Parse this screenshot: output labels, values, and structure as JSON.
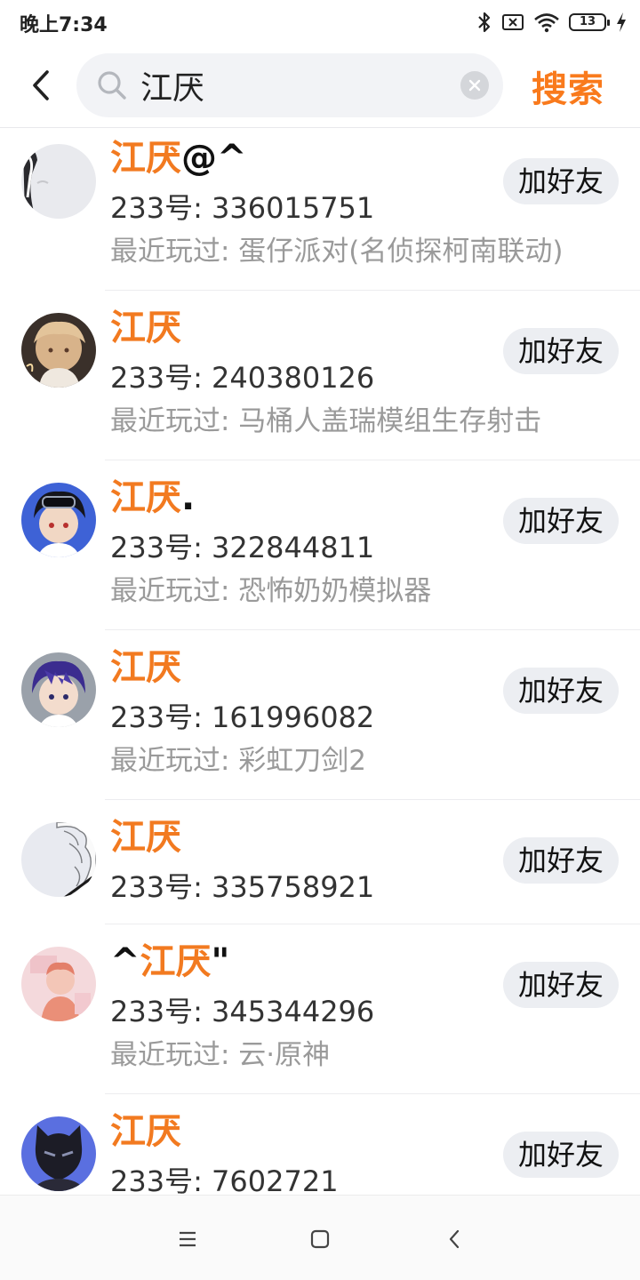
{
  "status_bar": {
    "time": "晚上7:34",
    "battery": "13",
    "icons": [
      "bluetooth-icon",
      "no-sim-icon",
      "wifi-icon",
      "battery-icon",
      "charging-icon"
    ]
  },
  "header": {
    "back_icon": "chevron-left-icon",
    "search_value": "江厌",
    "search_button": "搜索"
  },
  "colors": {
    "accent": "#f97a1c",
    "name_highlight": "#f27a20",
    "button_bg": "#eceef2",
    "secondary_text": "#9a9a9a"
  },
  "results": [
    {
      "prefix": "",
      "highlight": "江厌",
      "suffix": "@^",
      "id": "233号: 336015751",
      "played": "最近玩过: 蛋仔派对(名侦探柯南联动)",
      "add_label": "加好友"
    },
    {
      "prefix": "",
      "highlight": "江厌",
      "suffix": "",
      "id": "233号: 240380126",
      "played": "最近玩过: 马桶人盖瑞模组生存射击",
      "add_label": "加好友"
    },
    {
      "prefix": "",
      "highlight": "江厌",
      "suffix": ".",
      "id": "233号: 322844811",
      "played": "最近玩过: 恐怖奶奶模拟器",
      "add_label": "加好友"
    },
    {
      "prefix": "",
      "highlight": "江厌",
      "suffix": "",
      "id": "233号: 161996082",
      "played": "最近玩过: 彩虹刀剑2",
      "add_label": "加好友"
    },
    {
      "prefix": "",
      "highlight": "江厌",
      "suffix": "",
      "id": "233号: 335758921",
      "played": "",
      "add_label": "加好友"
    },
    {
      "prefix": "^",
      "highlight": "江厌",
      "suffix": "\"",
      "id": "233号: 345344296",
      "played": "最近玩过: 云·原神",
      "add_label": "加好友"
    },
    {
      "prefix": "",
      "highlight": "江厌",
      "suffix": "",
      "id": "233号: 7602721",
      "played": "",
      "add_label": "加好友"
    }
  ],
  "nav_bar": {
    "buttons": [
      "menu-icon",
      "home-icon",
      "back-icon"
    ]
  }
}
